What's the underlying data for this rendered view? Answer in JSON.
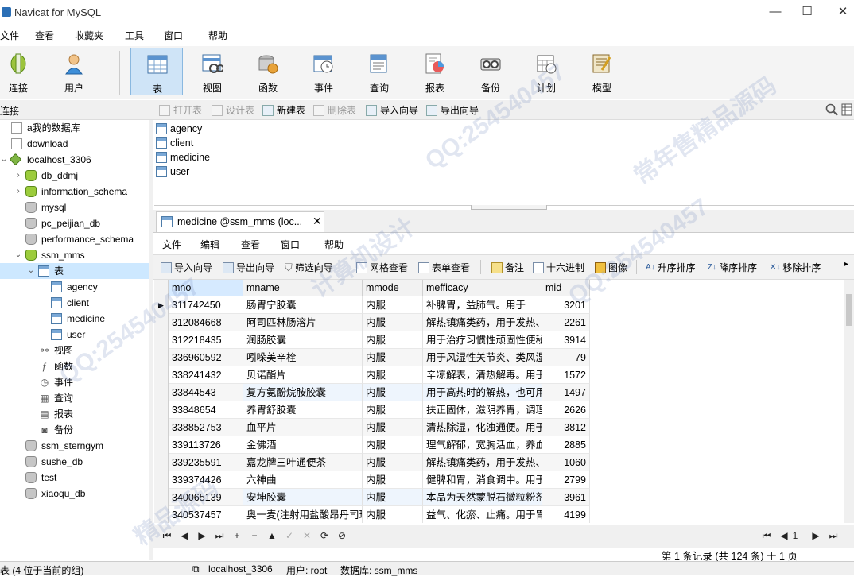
{
  "window": {
    "title": "Navicat for MySQL",
    "controls": [
      "—",
      "☐",
      "✕"
    ]
  },
  "menubar": [
    "文件",
    "查看",
    "收藏夹",
    "工具",
    "窗口",
    "帮助"
  ],
  "main_toolbar": [
    {
      "label": "连接",
      "icon": "connection-icon"
    },
    {
      "label": "用户",
      "icon": "user-icon"
    },
    {
      "label": "表",
      "icon": "table-icon",
      "active": true
    },
    {
      "label": "视图",
      "icon": "view-icon"
    },
    {
      "label": "函数",
      "icon": "function-icon"
    },
    {
      "label": "事件",
      "icon": "event-icon"
    },
    {
      "label": "查询",
      "icon": "query-icon"
    },
    {
      "label": "报表",
      "icon": "report-icon"
    },
    {
      "label": "备份",
      "icon": "backup-icon"
    },
    {
      "label": "计划",
      "icon": "schedule-icon"
    },
    {
      "label": "模型",
      "icon": "model-icon"
    }
  ],
  "connection_header": "连接",
  "object_toolbar": [
    {
      "label": "打开表",
      "enabled": false
    },
    {
      "label": "设计表",
      "enabled": false
    },
    {
      "label": "新建表",
      "enabled": true
    },
    {
      "label": "删除表",
      "enabled": false
    },
    {
      "label": "导入向导",
      "enabled": true
    },
    {
      "label": "导出向导",
      "enabled": true
    }
  ],
  "tree": [
    {
      "label": "a我的数据库",
      "icon": "doc",
      "level": 0
    },
    {
      "label": "download",
      "icon": "doc",
      "level": 0
    },
    {
      "label": "localhost_3306",
      "icon": "conn",
      "level": 0,
      "expanded": true
    },
    {
      "label": "db_ddmj",
      "icon": "db-green",
      "level": 1,
      "collapsed": true
    },
    {
      "label": "information_schema",
      "icon": "db-green",
      "level": 1,
      "collapsed": true
    },
    {
      "label": "mysql",
      "icon": "db-gray",
      "level": 1
    },
    {
      "label": "pc_peijian_db",
      "icon": "db-gray",
      "level": 1
    },
    {
      "label": "performance_schema",
      "icon": "db-gray",
      "level": 1
    },
    {
      "label": "ssm_mms",
      "icon": "db-green",
      "level": 1,
      "expanded": true
    },
    {
      "label": "表",
      "icon": "table",
      "level": 2,
      "expanded": true,
      "selected": true
    },
    {
      "label": "agency",
      "icon": "table",
      "level": 3
    },
    {
      "label": "client",
      "icon": "table",
      "level": 3
    },
    {
      "label": "medicine",
      "icon": "table",
      "level": 3
    },
    {
      "label": "user",
      "icon": "table",
      "level": 3
    },
    {
      "label": "视图",
      "icon": "glyph",
      "glyph": "⚯",
      "level": 2
    },
    {
      "label": "函数",
      "icon": "glyph",
      "glyph": "ƒ",
      "level": 2
    },
    {
      "label": "事件",
      "icon": "glyph",
      "glyph": "◷",
      "level": 2
    },
    {
      "label": "查询",
      "icon": "glyph",
      "glyph": "▦",
      "level": 2
    },
    {
      "label": "报表",
      "icon": "glyph",
      "glyph": "▤",
      "level": 2
    },
    {
      "label": "备份",
      "icon": "glyph",
      "glyph": "◙",
      "level": 2
    },
    {
      "label": "ssm_sterngym",
      "icon": "db-gray",
      "level": 1
    },
    {
      "label": "sushe_db",
      "icon": "db-gray",
      "level": 1
    },
    {
      "label": "test",
      "icon": "db-gray",
      "level": 1
    },
    {
      "label": "xiaoqu_db",
      "icon": "db-gray",
      "level": 1
    }
  ],
  "object_list": [
    "agency",
    "client",
    "medicine",
    "user"
  ],
  "doc_tab": {
    "label": "medicine @ssm_mms (loc...",
    "close": "✕"
  },
  "inner_menu": [
    "文件",
    "编辑",
    "查看",
    "窗口",
    "帮助"
  ],
  "inner_toolbar": [
    {
      "label": "导入向导"
    },
    {
      "label": "导出向导"
    },
    {
      "label": "筛选向导"
    },
    {
      "label": "网格查看"
    },
    {
      "label": "表单查看"
    },
    {
      "label": "备注"
    },
    {
      "label": "十六进制"
    },
    {
      "label": "图像"
    },
    {
      "label": "升序排序"
    },
    {
      "label": "降序排序"
    },
    {
      "label": "移除排序"
    }
  ],
  "grid": {
    "columns": [
      "mno",
      "mname",
      "mmode",
      "mefficacy",
      "mid"
    ],
    "rows": [
      [
        "311742450",
        "肠胃宁胶囊",
        "内服",
        "    补脾胃，益肺气。用于",
        "3201"
      ],
      [
        "312084668",
        "阿司匹林肠溶片",
        "内服",
        "解热镇痛类药，用于发热、",
        "2261"
      ],
      [
        "312218435",
        "润肠胶囊",
        "内服",
        "用于治疗习惯性顽固性便秘",
        "3914"
      ],
      [
        "336960592",
        "吲哚美辛栓",
        "内服",
        "用于风湿性关节炎、类风湿",
        "79"
      ],
      [
        "338241432",
        "贝诺酯片",
        "内服",
        "辛凉解表，清热解毒。用于",
        "1572"
      ],
      [
        "33844543",
        "复方氨酚烷胺胶囊",
        "内服",
        "用于高热时的解热，也可用",
        "1497"
      ],
      [
        "33848654",
        "养胃舒胶囊",
        "内服",
        "扶正固体，滋阴养胃，调理",
        "2626"
      ],
      [
        "338852753",
        "血平片",
        "内服",
        "清热除湿，化浊通便。用于",
        "3812"
      ],
      [
        "339113726",
        "金佛酒",
        "内服",
        "理气解郁，宽胸活血，养血",
        "2885"
      ],
      [
        "339235591",
        "嘉龙牌三叶通便茶",
        "内服",
        "解热镇痛类药，用于发热、",
        "1060"
      ],
      [
        "339374426",
        "六神曲",
        "内服",
        "健脾和胃，消食调中。用于",
        "2799"
      ],
      [
        "340065139",
        "安坤胶囊",
        "内服",
        "本品为天然蒙脱石微粒粉剂",
        "3961"
      ],
      [
        "340537457",
        "奥一麦(注射用盐酸昂丹司琼",
        "内服",
        "益气、化瘀、止痛。用于胃",
        "4199"
      ]
    ]
  },
  "navigation": {
    "buttons": [
      "⏮",
      "◀",
      "▶",
      "⏭",
      "+",
      "−",
      "▲",
      "✓",
      "✕",
      "⟳",
      "⊘"
    ],
    "page_right": [
      "⏮",
      "◀",
      "1",
      "▶",
      "⏭"
    ],
    "record_info": "第 1 条记录 (共 124 条) 于 1 页"
  },
  "statusbar": {
    "left": "表 (4 位于当前的组)",
    "connection": "localhost_3306",
    "user": "用户: root",
    "database": "数据库: ssm_mms"
  },
  "watermark": [
    "QQ:254540457",
    "精品源码",
    "计算机设计",
    "常年售精品源码"
  ]
}
